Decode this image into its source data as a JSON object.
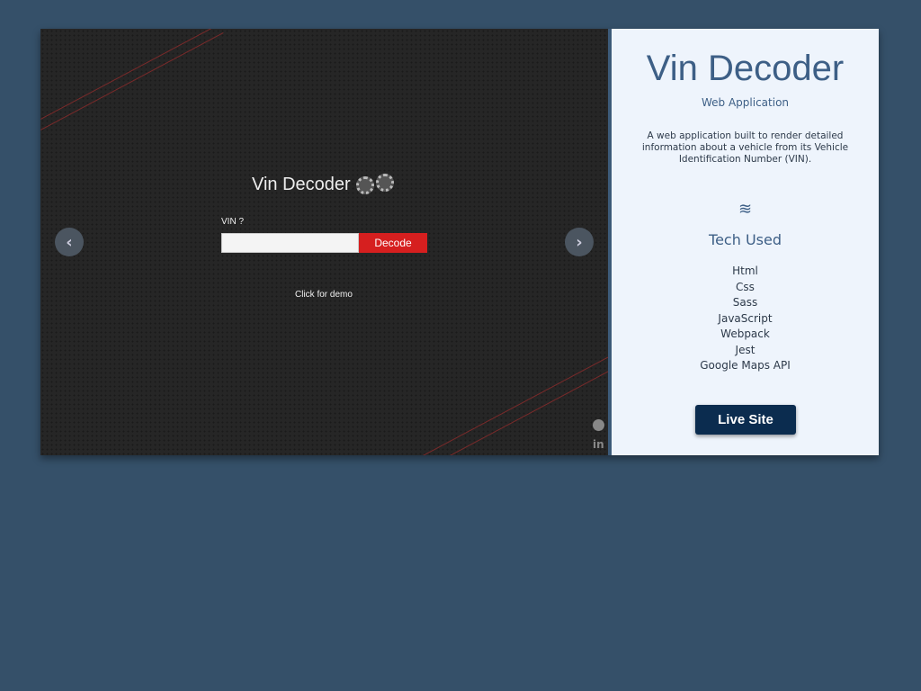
{
  "demo": {
    "app_title": "Vin Decoder",
    "vin_label": "VIN ?",
    "vin_value": "",
    "decode_label": "Decode",
    "demo_link": "Click for demo",
    "prev_label": "‹",
    "next_label": "›",
    "github_icon": "github-icon",
    "linkedin_label": "in"
  },
  "panel": {
    "title": "Vin Decoder",
    "subtitle": "Web Application",
    "description": "A web application built to render detailed information about a vehicle from its Vehicle Identification Number (VIN).",
    "tech_heading": "Tech Used",
    "tech": [
      "Html",
      "Css",
      "Sass",
      "JavaScript",
      "Webpack",
      "Jest",
      "Google Maps API"
    ],
    "live_label": "Live Site"
  },
  "colors": {
    "background": "#355069",
    "decode": "#d61f1f",
    "live": "#0b2c4f",
    "accent": "#3d5f86"
  }
}
